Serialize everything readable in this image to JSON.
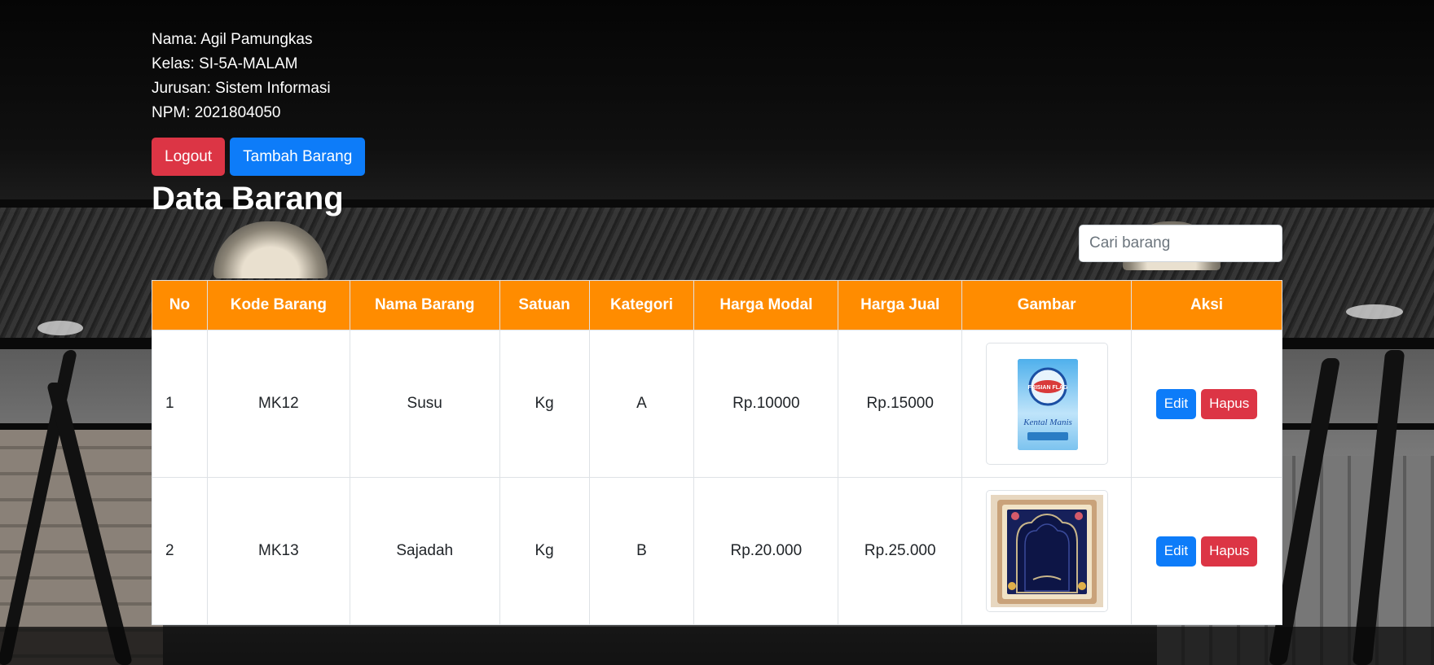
{
  "student": {
    "nama": "Nama: Agil Pamungkas",
    "kelas": "Kelas: SI-5A-MALAM",
    "jurusan": "Jurusan: Sistem Informasi",
    "npm": "NPM: 2021804050"
  },
  "actions": {
    "logout_label": "Logout",
    "add_label": "Tambah Barang"
  },
  "page_title": "Data Barang",
  "search": {
    "placeholder": "Cari barang"
  },
  "table": {
    "headers": [
      "No",
      "Kode Barang",
      "Nama Barang",
      "Satuan",
      "Kategori",
      "Harga Modal",
      "Harga Jual",
      "Gambar",
      "Aksi"
    ],
    "rows": [
      {
        "no": "1",
        "kode": "MK12",
        "nama": "Susu",
        "satuan": "Kg",
        "kategori": "A",
        "modal": "Rp.10000",
        "jual": "Rp.15000",
        "gambar": {
          "brand": "FRISIAN FLAG",
          "product": "Kental Manis"
        },
        "edit_label": "Edit",
        "hapus_label": "Hapus"
      },
      {
        "no": "2",
        "kode": "MK13",
        "nama": "Sajadah",
        "satuan": "Kg",
        "kategori": "B",
        "modal": "Rp.20.000",
        "jual": "Rp.25.000",
        "gambar": {},
        "edit_label": "Edit",
        "hapus_label": "Hapus"
      }
    ]
  },
  "colors": {
    "header_orange": "#ff8c00",
    "danger": "#dc3545",
    "primary": "#0d7cf9"
  }
}
